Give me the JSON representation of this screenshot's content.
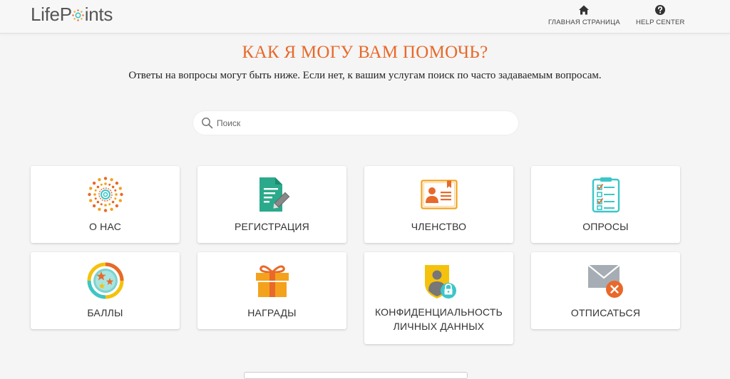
{
  "header": {
    "logo_text_before": "LifeP",
    "logo_text_after": "ints",
    "nav": {
      "home_label": "ГЛАВНАЯ СТРАНИЦА",
      "home_icon": "home-icon",
      "help_label": "HELP CENTER",
      "help_icon": "question-circle-icon"
    }
  },
  "main": {
    "title": "КАК Я МОГУ ВАМ ПОМОЧЬ?",
    "subtitle": "Ответы на вопросы могут быть ниже. Если нет, к вашим услугам поиск по часто задаваемым вопросам.",
    "search": {
      "placeholder": "Поиск",
      "value": "",
      "icon": "search-icon"
    }
  },
  "categories": [
    {
      "label": "О НАС",
      "icon": "sunburst-icon"
    },
    {
      "label": "РЕГИСТРАЦИЯ",
      "icon": "document-edit-icon"
    },
    {
      "label": "ЧЛЕНСТВО",
      "icon": "id-card-icon"
    },
    {
      "label": "ОПРОСЫ",
      "icon": "checklist-clipboard-icon"
    },
    {
      "label": "БАЛЛЫ",
      "icon": "points-stars-icon"
    },
    {
      "label": "НАГРАДЫ",
      "icon": "gift-icon"
    },
    {
      "label": "КОНФИДЕНЦИАЛЬНОСТЬ ЛИЧНЫХ ДАННЫХ",
      "icon": "privacy-shield-lock-icon"
    },
    {
      "label": "ОТПИСАТЬСЯ",
      "icon": "unsubscribe-envelope-icon"
    }
  ],
  "colors": {
    "accent_orange": "#e8692a",
    "teal": "#2aaa8a",
    "cyan": "#3cc6c8",
    "yellow": "#f4c20d"
  }
}
